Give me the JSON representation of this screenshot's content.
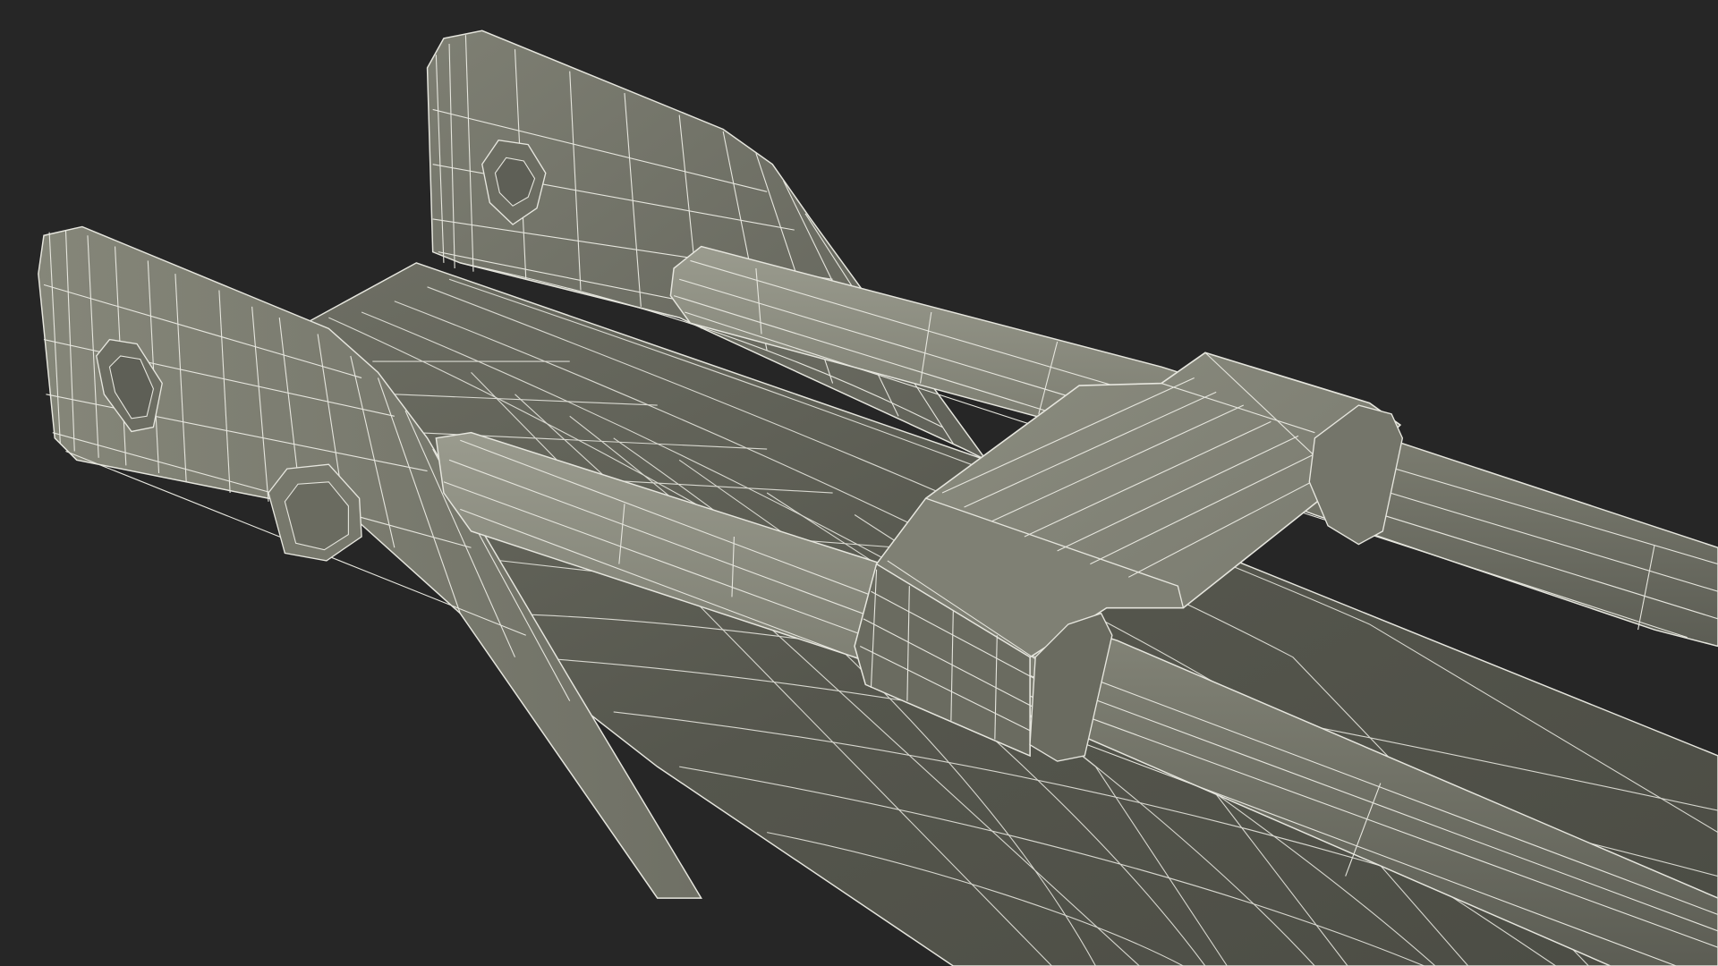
{
  "scene": {
    "subject": "wireframe-mechanical-bracket",
    "colors": {
      "background": "#262626",
      "surface": "#7b7c70",
      "surface_light": "#8a8b7e",
      "surface_dark": "#5a5b52",
      "shadow": "#45463f",
      "wire": "#e6e6de"
    },
    "parts": [
      {
        "id": "left-plate",
        "icon": "bracket-plate"
      },
      {
        "id": "right-plate",
        "icon": "bracket-plate"
      },
      {
        "id": "channel-base",
        "icon": "curved-surface"
      },
      {
        "id": "upper-rod",
        "icon": "cylinder-rod"
      },
      {
        "id": "lower-rod",
        "icon": "cylinder-rod"
      },
      {
        "id": "sliding-block",
        "icon": "block"
      },
      {
        "id": "bolt-heads",
        "icon": "hex-bolt"
      }
    ]
  }
}
